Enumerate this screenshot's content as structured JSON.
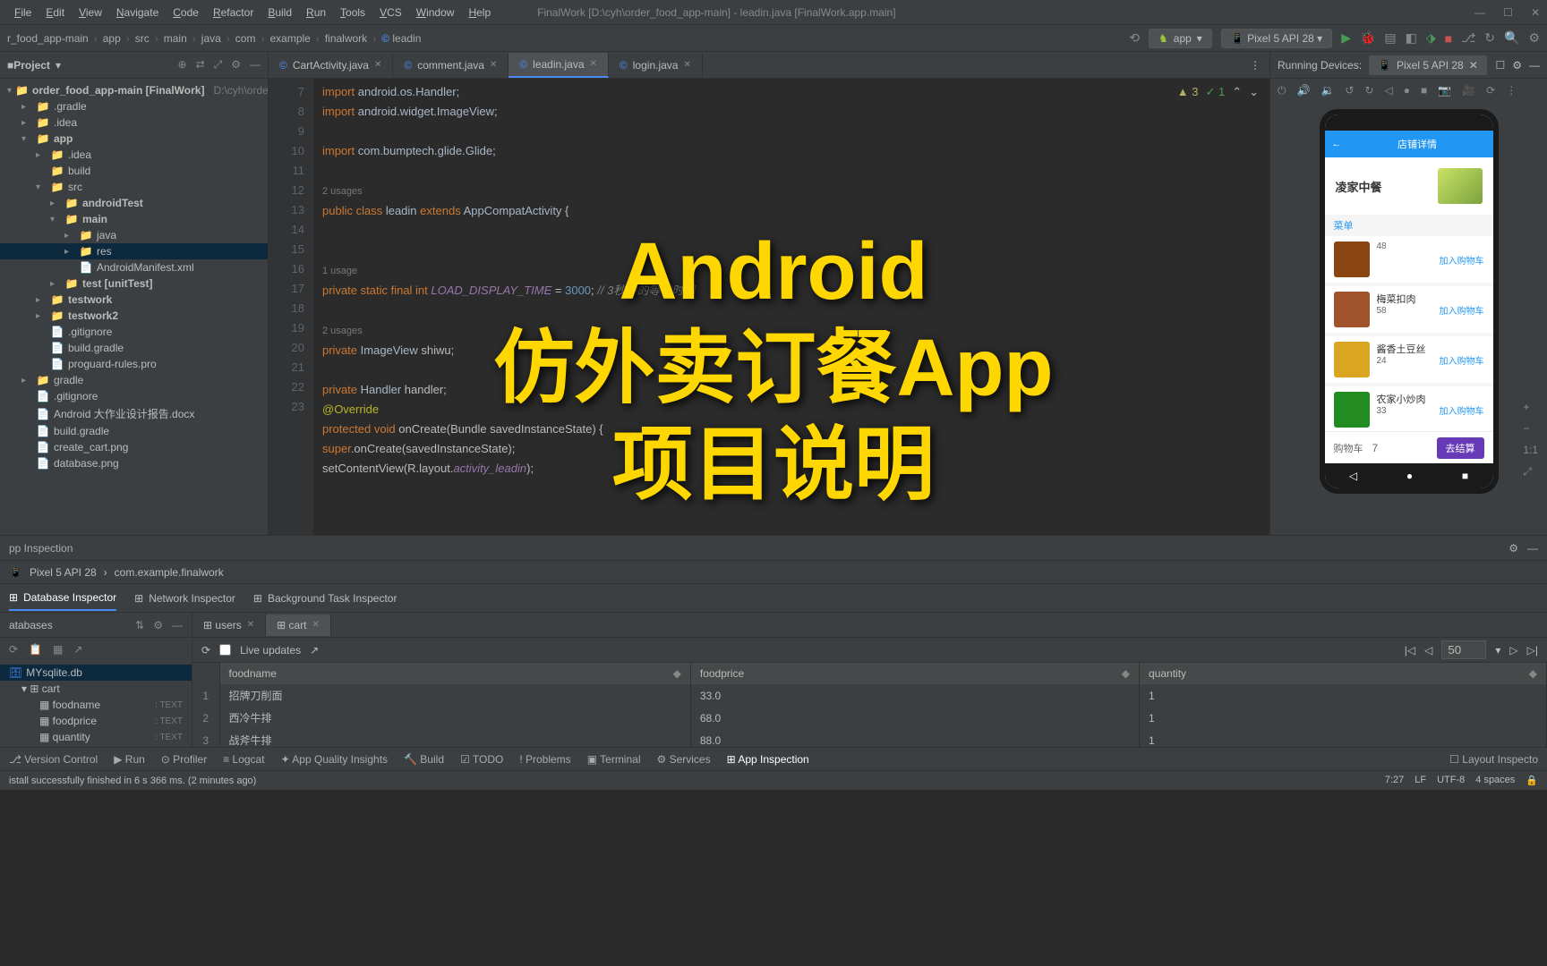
{
  "window": {
    "title": "FinalWork [D:\\cyh\\order_food_app-main] - leadin.java [FinalWork.app.main]"
  },
  "menu": [
    "File",
    "Edit",
    "View",
    "Navigate",
    "Code",
    "Refactor",
    "Build",
    "Run",
    "Tools",
    "VCS",
    "Window",
    "Help"
  ],
  "breadcrumb": [
    "r_food_app-main",
    "app",
    "src",
    "main",
    "java",
    "com",
    "example",
    "finalwork",
    "leadin"
  ],
  "run_config": "app",
  "device": "Pixel 5 API 28",
  "sidebar_title": "Project",
  "project_tree": {
    "root": "order_food_app-main [FinalWork]",
    "root_path": "D:\\cyh\\orde",
    "items": [
      {
        "d": 1,
        "a": "▸",
        "i": "📁",
        "n": ".gradle",
        "cls": "orange"
      },
      {
        "d": 1,
        "a": "▸",
        "i": "📁",
        "n": ".idea",
        "cls": "orange"
      },
      {
        "d": 1,
        "a": "▾",
        "i": "📁",
        "n": "app",
        "cls": "",
        "bold": true
      },
      {
        "d": 2,
        "a": "▸",
        "i": "📁",
        "n": ".idea",
        "cls": ""
      },
      {
        "d": 2,
        "a": "",
        "i": "📁",
        "n": "build",
        "cls": "orange"
      },
      {
        "d": 2,
        "a": "▾",
        "i": "📁",
        "n": "src",
        "cls": ""
      },
      {
        "d": 3,
        "a": "▸",
        "i": "📁",
        "n": "androidTest",
        "cls": "blue",
        "bold": true
      },
      {
        "d": 3,
        "a": "▾",
        "i": "📁",
        "n": "main",
        "cls": "blue",
        "bold": true
      },
      {
        "d": 4,
        "a": "▸",
        "i": "📁",
        "n": "java",
        "cls": "blue"
      },
      {
        "d": 4,
        "a": "▸",
        "i": "📁",
        "n": "res",
        "cls": "",
        "sel": true
      },
      {
        "d": 4,
        "a": "",
        "i": "📄",
        "n": "AndroidManifest.xml",
        "cls": ""
      },
      {
        "d": 3,
        "a": "▸",
        "i": "📁",
        "n": "test [unitTest]",
        "cls": "blue",
        "bold": true
      },
      {
        "d": 2,
        "a": "▸",
        "i": "📁",
        "n": "testwork",
        "cls": "blue",
        "bold": true
      },
      {
        "d": 2,
        "a": "▸",
        "i": "📁",
        "n": "testwork2",
        "cls": "blue",
        "bold": true
      },
      {
        "d": 2,
        "a": "",
        "i": "📄",
        "n": ".gitignore",
        "cls": ""
      },
      {
        "d": 2,
        "a": "",
        "i": "📄",
        "n": "build.gradle",
        "cls": ""
      },
      {
        "d": 2,
        "a": "",
        "i": "📄",
        "n": "proguard-rules.pro",
        "cls": ""
      },
      {
        "d": 1,
        "a": "▸",
        "i": "📁",
        "n": "gradle",
        "cls": ""
      },
      {
        "d": 1,
        "a": "",
        "i": "📄",
        "n": ".gitignore",
        "cls": ""
      },
      {
        "d": 1,
        "a": "",
        "i": "📄",
        "n": "Android 大作业设计报告.docx",
        "cls": ""
      },
      {
        "d": 1,
        "a": "",
        "i": "📄",
        "n": "build.gradle",
        "cls": ""
      },
      {
        "d": 1,
        "a": "",
        "i": "📄",
        "n": "create_cart.png",
        "cls": ""
      },
      {
        "d": 1,
        "a": "",
        "i": "📄",
        "n": "database.png",
        "cls": ""
      }
    ]
  },
  "editor_tabs": [
    {
      "name": "CartActivity.java",
      "active": false
    },
    {
      "name": "comment.java",
      "active": false
    },
    {
      "name": "leadin.java",
      "active": true
    },
    {
      "name": "login.java",
      "active": false
    }
  ],
  "code_lines": [
    {
      "n": 7,
      "html": "<span class='kw'>import</span> <span class='cls'>android.os.Handler</span>;"
    },
    {
      "n": 8,
      "html": "<span class='kw'>import</span> <span class='cls'>android.widget.ImageView</span>;"
    },
    {
      "n": 9,
      "html": ""
    },
    {
      "n": 10,
      "html": "<span class='kw'>import</span> <span class='cls'>com.bumptech.glide.Glide</span>;"
    },
    {
      "n": 11,
      "html": ""
    },
    {
      "n": "",
      "html": "<span class='hint'>2 usages</span>"
    },
    {
      "n": 12,
      "html": "<span class='kw'>public class</span> <span class='cls'>leadin</span> <span class='kw'>extends</span> <span class='cls'>AppCompatActivity</span> {"
    },
    {
      "n": 13,
      "html": ""
    },
    {
      "n": 14,
      "html": ""
    },
    {
      "n": "",
      "html": "    <span class='hint'>1 usage</span>"
    },
    {
      "n": 15,
      "html": "    <span class='kw'>private static final int</span> <span class='const'>LOAD_DISPLAY_TIME</span> = <span class='num'>3000</span>;   <span class='comment'>// 3秒钟的等待时间</span>"
    },
    {
      "n": 16,
      "html": ""
    },
    {
      "n": "",
      "html": "    <span class='hint'>2 usages</span>"
    },
    {
      "n": 17,
      "html": "    <span class='kw'>private</span> <span class='cls'>ImageView</span> shiwu;"
    },
    {
      "n": 18,
      "html": ""
    },
    {
      "n": 19,
      "html": "    <span class='kw'>private</span> <span class='cls'>Handler</span> handler;"
    },
    {
      "n": 20,
      "html": "    <span class='ann'>@Override</span>"
    },
    {
      "n": 21,
      "html": "    <span class='kw'>protected void</span> onCreate(Bundle savedInstanceState) {"
    },
    {
      "n": 22,
      "html": "        <span class='kw'>super</span>.onCreate(savedInstanceState);"
    },
    {
      "n": 23,
      "html": "        setContentView(R.layout.<span class='const'>activity_leadin</span>);"
    }
  ],
  "code_indicators": {
    "warn": "3",
    "ok": "1"
  },
  "overlay": {
    "line1": "Android",
    "line2": "仿外卖订餐App",
    "line3": "项目说明"
  },
  "emulator": {
    "header": "Running Devices:",
    "tab": "Pixel 5 API 28",
    "appbar": "店铺详情",
    "shop_name": "凌家中餐",
    "menu_label": "菜单",
    "foods": [
      {
        "name": "",
        "price": "48",
        "add": "加入购物车",
        "color": "#8b4513"
      },
      {
        "name": "梅菜扣肉",
        "price": "58",
        "add": "加入购物车",
        "color": "#a0522d"
      },
      {
        "name": "酱香土豆丝",
        "price": "24",
        "add": "加入购物车",
        "color": "#daa520"
      },
      {
        "name": "农家小炒肉",
        "price": "33",
        "add": "加入购物车",
        "color": "#228b22"
      }
    ],
    "cart_label": "购物车",
    "cart_count": "7",
    "checkout": "去结算"
  },
  "inspection": {
    "title": "pp Inspection",
    "breadcrumb": [
      "Pixel 5 API 28",
      "com.example.finalwork"
    ],
    "tabs": [
      "Database Inspector",
      "Network Inspector",
      "Background Task Inspector"
    ],
    "active_tab": 0,
    "db_header": "atabases",
    "db_name": "MYsqlite.db",
    "table_name": "cart",
    "columns": [
      {
        "name": "foodname",
        "type": "TEXT"
      },
      {
        "name": "foodprice",
        "type": "TEXT"
      },
      {
        "name": "quantity",
        "type": "TEXT"
      }
    ],
    "data_tabs": [
      "users",
      "cart"
    ],
    "active_data_tab": 1,
    "live_updates": "Live updates",
    "page_size": "50",
    "headers": [
      "foodname",
      "foodprice",
      "quantity"
    ],
    "rows": [
      {
        "n": "1",
        "foodname": "招牌刀削面",
        "foodprice": "33.0",
        "quantity": "1"
      },
      {
        "n": "2",
        "foodname": "西冷牛排",
        "foodprice": "68.0",
        "quantity": "1"
      },
      {
        "n": "3",
        "foodname": "战斧牛排",
        "foodprice": "88.0",
        "quantity": "1"
      }
    ]
  },
  "bottom_tabs": [
    "Version Control",
    "Run",
    "Profiler",
    "Logcat",
    "App Quality Insights",
    "Build",
    "TODO",
    "Problems",
    "Terminal",
    "Services",
    "App Inspection"
  ],
  "bottom_tabs_right": "Layout Inspecto",
  "status": {
    "msg": "istall successfully finished in 6 s 366 ms. (2 minutes ago)",
    "pos": "7:27",
    "lf": "LF",
    "enc": "UTF-8",
    "indent": "4 spaces"
  }
}
